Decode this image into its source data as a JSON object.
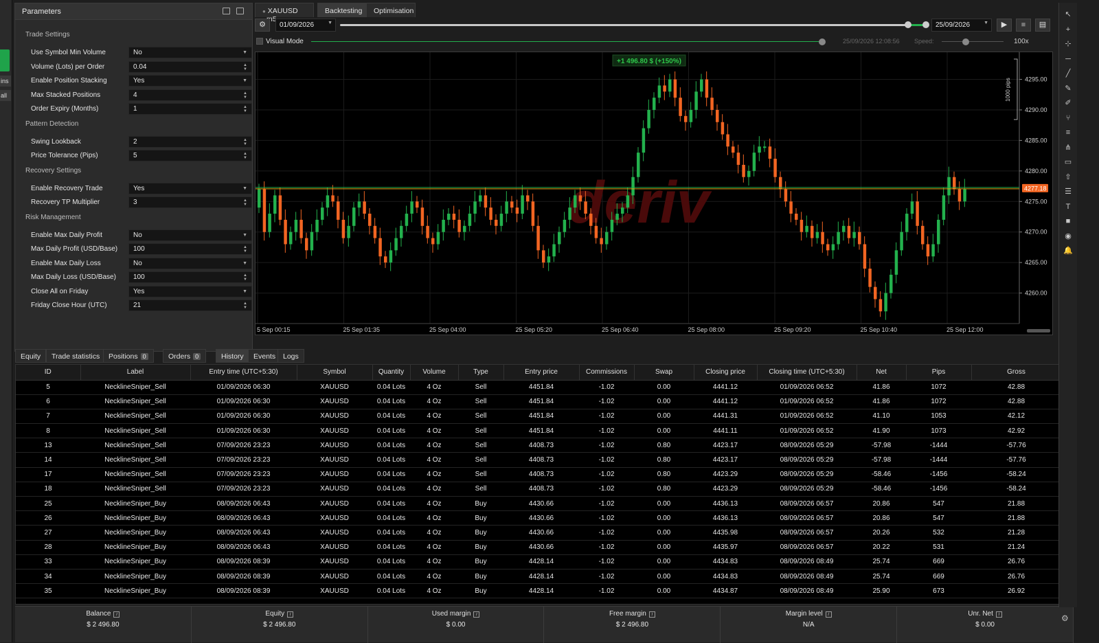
{
  "left_strip": {
    "items": [
      "ins",
      "all"
    ]
  },
  "parameters": {
    "title": "Parameters",
    "sections": [
      {
        "name": "Trade Settings",
        "rows": [
          {
            "label": "Use Symbol Min Volume",
            "value": "No",
            "kind": "select"
          },
          {
            "label": "Volume (Lots) per Order",
            "value": "0.04",
            "kind": "spin"
          },
          {
            "label": "Enable Position Stacking",
            "value": "Yes",
            "kind": "select"
          },
          {
            "label": "Max Stacked Positions",
            "value": "4",
            "kind": "spin"
          },
          {
            "label": "Order Expiry (Months)",
            "value": "1",
            "kind": "spin"
          }
        ]
      },
      {
        "name": "Pattern Detection",
        "rows": [
          {
            "label": "Swing Lookback",
            "value": "2",
            "kind": "spin"
          },
          {
            "label": "Price Tolerance (Pips)",
            "value": "5",
            "kind": "spin"
          }
        ]
      },
      {
        "name": "Recovery Settings",
        "rows": [
          {
            "label": "Enable Recovery Trade",
            "value": "Yes",
            "kind": "select"
          },
          {
            "label": "Recovery TP Multiplier",
            "value": "3",
            "kind": "spin"
          }
        ]
      },
      {
        "name": "Risk Management",
        "rows": [
          {
            "label": "Enable Max Daily Profit",
            "value": "No",
            "kind": "select"
          },
          {
            "label": "Max Daily Profit (USD/Base)",
            "value": "100",
            "kind": "spin"
          },
          {
            "label": "Enable Max Daily Loss",
            "value": "No",
            "kind": "select"
          },
          {
            "label": "Max Daily Loss (USD/Base)",
            "value": "100",
            "kind": "spin"
          },
          {
            "label": "Close All on Friday",
            "value": "Yes",
            "kind": "select"
          },
          {
            "label": "Friday Close Hour (UTC)",
            "value": "21",
            "kind": "spin"
          }
        ]
      }
    ]
  },
  "top_tabs": {
    "symbol": "XAUUSD",
    "timeframe": "m5",
    "backtesting": "Backtesting",
    "optimisation": "Optimisation"
  },
  "toolbar": {
    "start_date": "01/09/2026",
    "end_date": "25/09/2026",
    "range_fraction": [
      0.0,
      1.0
    ]
  },
  "visual_mode": {
    "label": "Visual Mode",
    "timestamp": "25/09/2026 12:08:56",
    "speed_label": "Speed:",
    "speed_value": "100x"
  },
  "chart": {
    "profit_label": "+1 496.80 $ (+150%)",
    "watermark": "deriv",
    "scale_label": "1000 pips",
    "current_price": "4277.18",
    "accent_up": "#23b14d",
    "accent_down": "#f26522"
  },
  "chart_data": {
    "type": "candlestick",
    "ylim": [
      4255,
      4299
    ],
    "y_ticks": [
      "4295.00",
      "4290.00",
      "4285.00",
      "4280.00",
      "4275.00",
      "4270.00",
      "4265.00",
      "4260.00"
    ],
    "x_ticks": [
      "5 Sep 00:15",
      "25 Sep 01:35",
      "25 Sep 04:00",
      "25 Sep 05:20",
      "25 Sep 06:40",
      "25 Sep 08:00",
      "25 Sep 09:20",
      "25 Sep 10:40",
      "25 Sep 12:00"
    ],
    "current_price": 4277.18,
    "closes": [
      4277,
      4270,
      4273,
      4276,
      4272,
      4268,
      4270,
      4272,
      4269,
      4267,
      4270,
      4272,
      4274,
      4276,
      4275,
      4272,
      4269,
      4271,
      4274,
      4275,
      4273,
      4271,
      4269,
      4266,
      4265,
      4267,
      4269,
      4271,
      4273,
      4275,
      4274,
      4271,
      4269,
      4268,
      4270,
      4272,
      4273,
      4272,
      4270,
      4271,
      4273,
      4275,
      4276,
      4274,
      4272,
      4271,
      4273,
      4275,
      4274,
      4273,
      4276,
      4275,
      4271,
      4267,
      4265,
      4266,
      4268,
      4270,
      4272,
      4274,
      4276,
      4275,
      4273,
      4271,
      4269,
      4268,
      4270,
      4272,
      4273,
      4274,
      4276,
      4279,
      4283,
      4287,
      4290,
      4292,
      4294,
      4293,
      4295,
      4292,
      4289,
      4288,
      4290,
      4293,
      4295,
      4292,
      4290,
      4288,
      4286,
      4284,
      4283,
      4281,
      4279,
      4280,
      4283,
      4284,
      4284,
      4282,
      4279,
      4277,
      4275,
      4273,
      4272,
      4270,
      4271,
      4269,
      4270,
      4268,
      4267,
      4268,
      4270,
      4271,
      4269,
      4270,
      4268,
      4264,
      4261,
      4259,
      4257,
      4260,
      4263,
      4267,
      4270,
      4273,
      4275,
      4271,
      4268,
      4266,
      4268,
      4272,
      4276,
      4279,
      4277,
      4275,
      4277
    ],
    "opens": [
      4274,
      4277,
      4270,
      4273,
      4276,
      4272,
      4268,
      4270,
      4272,
      4269,
      4267,
      4270,
      4272,
      4274,
      4276,
      4275,
      4272,
      4269,
      4271,
      4274,
      4275,
      4273,
      4271,
      4269,
      4266,
      4265,
      4267,
      4269,
      4271,
      4273,
      4275,
      4274,
      4271,
      4269,
      4268,
      4270,
      4272,
      4273,
      4272,
      4270,
      4271,
      4273,
      4275,
      4276,
      4274,
      4272,
      4271,
      4273,
      4275,
      4274,
      4273,
      4276,
      4275,
      4271,
      4267,
      4265,
      4266,
      4268,
      4270,
      4272,
      4274,
      4276,
      4275,
      4273,
      4271,
      4269,
      4268,
      4270,
      4272,
      4273,
      4274,
      4276,
      4279,
      4283,
      4287,
      4290,
      4292,
      4294,
      4293,
      4295,
      4292,
      4289,
      4288,
      4290,
      4293,
      4295,
      4292,
      4290,
      4288,
      4286,
      4284,
      4283,
      4281,
      4279,
      4280,
      4283,
      4284,
      4284,
      4282,
      4279,
      4277,
      4275,
      4273,
      4272,
      4270,
      4271,
      4269,
      4270,
      4268,
      4267,
      4268,
      4270,
      4271,
      4269,
      4270,
      4268,
      4264,
      4261,
      4259,
      4257,
      4260,
      4263,
      4267,
      4270,
      4273,
      4275,
      4271,
      4268,
      4266,
      4268,
      4272,
      4276,
      4279,
      4277,
      4275
    ]
  },
  "bottom_tabs": [
    {
      "label": "Equity"
    },
    {
      "label": "Trade statistics"
    },
    {
      "label": "Positions",
      "badge": "0"
    },
    {
      "label": "Orders",
      "badge": "0"
    },
    {
      "label": "History"
    },
    {
      "label": "Events"
    },
    {
      "label": "Logs"
    }
  ],
  "history": {
    "columns": [
      "ID",
      "Label",
      "Entry time (UTC+5:30)",
      "Symbol",
      "Quantity",
      "Volume",
      "Type",
      "Entry price",
      "Commissions",
      "Swap",
      "Closing price",
      "Closing time (UTC+5:30)",
      "Net",
      "Pips",
      "Gross"
    ],
    "rows": [
      [
        "5",
        "NecklineSniper_Sell",
        "01/09/2026 06:30",
        "XAUUSD",
        "0.04 Lots",
        "4 Oz",
        "Sell",
        "4451.84",
        "-1.02",
        "0.00",
        "4441.12",
        "01/09/2026 06:52",
        "41.86",
        "1072",
        "42.88"
      ],
      [
        "6",
        "NecklineSniper_Sell",
        "01/09/2026 06:30",
        "XAUUSD",
        "0.04 Lots",
        "4 Oz",
        "Sell",
        "4451.84",
        "-1.02",
        "0.00",
        "4441.12",
        "01/09/2026 06:52",
        "41.86",
        "1072",
        "42.88"
      ],
      [
        "7",
        "NecklineSniper_Sell",
        "01/09/2026 06:30",
        "XAUUSD",
        "0.04 Lots",
        "4 Oz",
        "Sell",
        "4451.84",
        "-1.02",
        "0.00",
        "4441.31",
        "01/09/2026 06:52",
        "41.10",
        "1053",
        "42.12"
      ],
      [
        "8",
        "NecklineSniper_Sell",
        "01/09/2026 06:30",
        "XAUUSD",
        "0.04 Lots",
        "4 Oz",
        "Sell",
        "4451.84",
        "-1.02",
        "0.00",
        "4441.11",
        "01/09/2026 06:52",
        "41.90",
        "1073",
        "42.92"
      ],
      [
        "13",
        "NecklineSniper_Sell",
        "07/09/2026 23:23",
        "XAUUSD",
        "0.04 Lots",
        "4 Oz",
        "Sell",
        "4408.73",
        "-1.02",
        "0.80",
        "4423.17",
        "08/09/2026 05:29",
        "-57.98",
        "-1444",
        "-57.76"
      ],
      [
        "14",
        "NecklineSniper_Sell",
        "07/09/2026 23:23",
        "XAUUSD",
        "0.04 Lots",
        "4 Oz",
        "Sell",
        "4408.73",
        "-1.02",
        "0.80",
        "4423.17",
        "08/09/2026 05:29",
        "-57.98",
        "-1444",
        "-57.76"
      ],
      [
        "17",
        "NecklineSniper_Sell",
        "07/09/2026 23:23",
        "XAUUSD",
        "0.04 Lots",
        "4 Oz",
        "Sell",
        "4408.73",
        "-1.02",
        "0.80",
        "4423.29",
        "08/09/2026 05:29",
        "-58.46",
        "-1456",
        "-58.24"
      ],
      [
        "18",
        "NecklineSniper_Sell",
        "07/09/2026 23:23",
        "XAUUSD",
        "0.04 Lots",
        "4 Oz",
        "Sell",
        "4408.73",
        "-1.02",
        "0.80",
        "4423.29",
        "08/09/2026 05:29",
        "-58.46",
        "-1456",
        "-58.24"
      ],
      [
        "25",
        "NecklineSniper_Buy",
        "08/09/2026 06:43",
        "XAUUSD",
        "0.04 Lots",
        "4 Oz",
        "Buy",
        "4430.66",
        "-1.02",
        "0.00",
        "4436.13",
        "08/09/2026 06:57",
        "20.86",
        "547",
        "21.88"
      ],
      [
        "26",
        "NecklineSniper_Buy",
        "08/09/2026 06:43",
        "XAUUSD",
        "0.04 Lots",
        "4 Oz",
        "Buy",
        "4430.66",
        "-1.02",
        "0.00",
        "4436.13",
        "08/09/2026 06:57",
        "20.86",
        "547",
        "21.88"
      ],
      [
        "27",
        "NecklineSniper_Buy",
        "08/09/2026 06:43",
        "XAUUSD",
        "0.04 Lots",
        "4 Oz",
        "Buy",
        "4430.66",
        "-1.02",
        "0.00",
        "4435.98",
        "08/09/2026 06:57",
        "20.26",
        "532",
        "21.28"
      ],
      [
        "28",
        "NecklineSniper_Buy",
        "08/09/2026 06:43",
        "XAUUSD",
        "0.04 Lots",
        "4 Oz",
        "Buy",
        "4430.66",
        "-1.02",
        "0.00",
        "4435.97",
        "08/09/2026 06:57",
        "20.22",
        "531",
        "21.24"
      ],
      [
        "33",
        "NecklineSniper_Buy",
        "08/09/2026 08:39",
        "XAUUSD",
        "0.04 Lots",
        "4 Oz",
        "Buy",
        "4428.14",
        "-1.02",
        "0.00",
        "4434.83",
        "08/09/2026 08:49",
        "25.74",
        "669",
        "26.76"
      ],
      [
        "34",
        "NecklineSniper_Buy",
        "08/09/2026 08:39",
        "XAUUSD",
        "0.04 Lots",
        "4 Oz",
        "Buy",
        "4428.14",
        "-1.02",
        "0.00",
        "4434.83",
        "08/09/2026 08:49",
        "25.74",
        "669",
        "26.76"
      ],
      [
        "35",
        "NecklineSniper_Buy",
        "08/09/2026 08:39",
        "XAUUSD",
        "0.04 Lots",
        "4 Oz",
        "Buy",
        "4428.14",
        "-1.02",
        "0.00",
        "4434.87",
        "08/09/2026 08:49",
        "25.90",
        "673",
        "26.92"
      ]
    ]
  },
  "footer": [
    {
      "label": "Balance",
      "value": "$ 2 496.80"
    },
    {
      "label": "Equity",
      "value": "$ 2 496.80"
    },
    {
      "label": "Used margin",
      "value": "$ 0.00"
    },
    {
      "label": "Free margin",
      "value": "$ 2 496.80"
    },
    {
      "label": "Margin level",
      "value": "N/A"
    },
    {
      "label": "Unr. Net",
      "value": "$ 0.00"
    }
  ],
  "right_toolbar": {
    "icons": [
      "cursor-icon",
      "crosshair-icon",
      "plus-icon",
      "horizontal-line-icon",
      "trend-line-icon",
      "pen-icon",
      "brush-icon",
      "fork-icon",
      "fibonacci-icon",
      "pitchfork-icon",
      "rectangle-icon",
      "arrow-up-icon",
      "levels-icon",
      "text-icon",
      "square-icon",
      "eye-icon",
      "bell-icon"
    ]
  }
}
